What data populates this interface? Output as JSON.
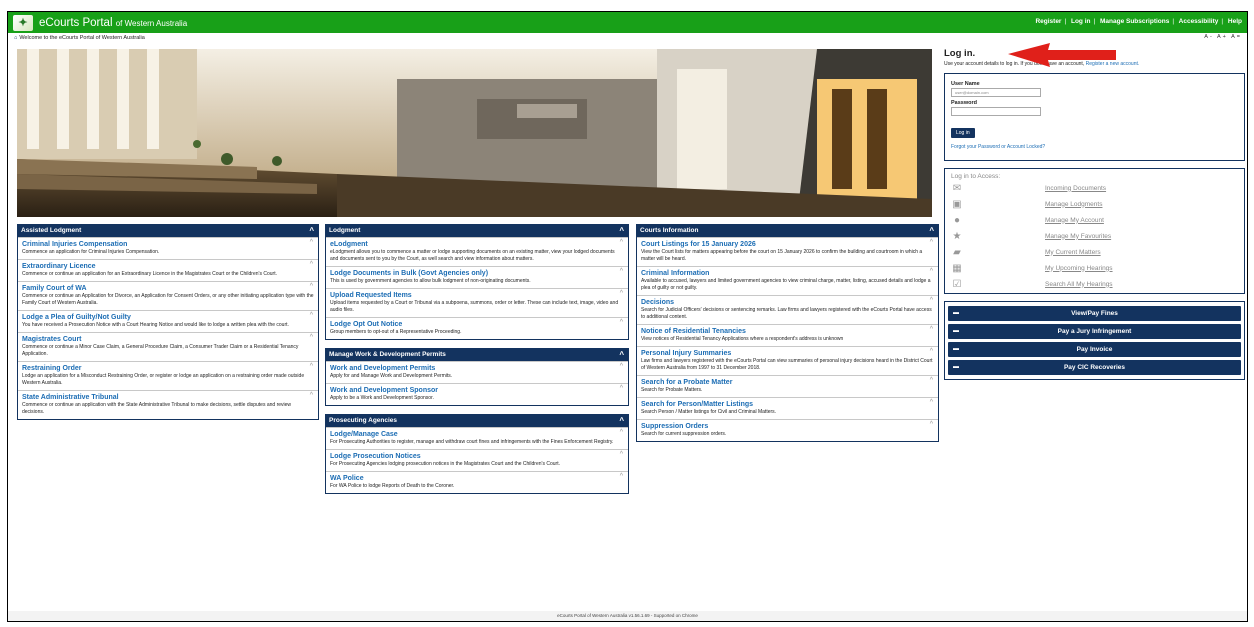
{
  "header": {
    "brand_main": "eCourts Portal",
    "brand_sub": "of Western Australia",
    "links": [
      "Register",
      "Log in",
      "Manage Subscriptions",
      "Accessibility",
      "Help"
    ]
  },
  "welcome": "Welcome to the eCourts Portal of Western Australia",
  "fontsize": "A- A+ A=",
  "panels": {
    "assisted": {
      "title": "Assisted Lodgment",
      "items": [
        {
          "title": "Criminal Injuries Compensation",
          "desc": "Commence an application for Criminal Injuries Compensation."
        },
        {
          "title": "Extraordinary Licence",
          "desc": "Commence or continue an application for an Extraordinary Licence in the Magistrates Court or the Children's Court."
        },
        {
          "title": "Family Court of WA",
          "desc": "Commence or continue an Application for Divorce, an Application for Consent Orders, or any other initiating application type with the Family Court of Western Australia."
        },
        {
          "title": "Lodge a Plea of Guilty/Not Guilty",
          "desc": "You have received a Prosecution Notice with a Court Hearing Notice and would like to lodge a written plea with the court."
        },
        {
          "title": "Magistrates Court",
          "desc": "Commence or continue a Minor Case Claim, a General Procedure Claim, a Consumer Trader Claim or a Residential Tenancy Application."
        },
        {
          "title": "Restraining Order",
          "desc": "Lodge an application for a Misconduct Restraining Order, or register or lodge an application on a restraining order made outside Western Australia."
        },
        {
          "title": "State Administrative Tribunal",
          "desc": "Commence or continue an application with the State Administrative Tribunal to make decisions, settle disputes and review decisions."
        }
      ]
    },
    "lodgment": {
      "title": "Lodgment",
      "items": [
        {
          "title": "eLodgment",
          "desc": "eLodgment allows you to commence a matter or lodge supporting documents on an existing matter, view your lodged documents and documents sent to you by the Court, as well search and view information about matters."
        },
        {
          "title": "Lodge Documents in Bulk (Govt Agencies only)",
          "desc": "This is used by government agencies to allow bulk lodgment of non-originating documents."
        },
        {
          "title": "Upload Requested Items",
          "desc": "Upload items requested by a Court or Tribunal via a subpoena, summons, order or letter. These can include text, image, video and audio files."
        },
        {
          "title": "Lodge Opt Out Notice",
          "desc": "Group members to opt-out of a Representative Proceeding."
        }
      ]
    },
    "workdev": {
      "title": "Manage Work & Development Permits",
      "items": [
        {
          "title": "Work and Development Permits",
          "desc": "Apply for and Manage Work and Development Permits."
        },
        {
          "title": "Work and Development Sponsor",
          "desc": "Apply to be a Work and Development Sponsor."
        }
      ]
    },
    "prosecuting": {
      "title": "Prosecuting Agencies",
      "items": [
        {
          "title": "Lodge/Manage Case",
          "desc": "For Prosecuting Authorities to register, manage and withdraw court fines and infringements with the Fines Enforcement Registry."
        },
        {
          "title": "Lodge Prosecution Notices",
          "desc": "For Prosecuting Agencies lodging prosecution notices in the Magistrates Court and the Children's Court."
        },
        {
          "title": "WA Police",
          "desc": "For WA Police to lodge Reports of Death to the Coroner."
        }
      ]
    },
    "courts": {
      "title": "Courts Information",
      "items": [
        {
          "title": "Court Listings for 15 January 2026",
          "desc": "View the Court lists for matters appearing before the court on 15 January 2026 to confirm the building and courtroom in which a matter will be heard."
        },
        {
          "title": "Criminal Information",
          "desc": "Available to accused, lawyers and limited government agencies to view criminal charge, matter, listing, accused details and lodge a plea of guilty or not guilty."
        },
        {
          "title": "Decisions",
          "desc": "Search for Judicial Officers' decisions or sentencing remarks. Law firms and lawyers registered with the eCourts Portal have access to additional content."
        },
        {
          "title": "Notice of Residential Tenancies",
          "desc": "View notices of Residential Tenancy Applications where a respondent's address is unknown"
        },
        {
          "title": "Personal Injury Summaries",
          "desc": "Law firms and lawyers registered with the eCourts Portal can view summaries of personal injury decisions heard in the District Court of Western Australia from 1997 to 31 December 2018."
        },
        {
          "title": "Search for a Probate Matter",
          "desc": "Search for Probate Matters."
        },
        {
          "title": "Search for Person/Matter Listings",
          "desc": "Search Person / Matter listings for Civil and Criminal Matters."
        },
        {
          "title": "Suppression Orders",
          "desc": "Search for current suppression orders."
        }
      ]
    }
  },
  "login": {
    "heading": "Log in.",
    "intro_text": "Use your account details to log in. If you don't have an account,",
    "intro_link": "Register a new account.",
    "username_label": "User Name",
    "username_placeholder": "user@domain.com",
    "password_label": "Password",
    "button": "Log in",
    "forgot": "Forgot your Password or Account Locked?"
  },
  "access": {
    "heading": "Log in to Access:",
    "items": [
      {
        "icon": "envelope-icon",
        "label": "Incoming Documents"
      },
      {
        "icon": "briefcase-icon",
        "label": "Manage Lodgments"
      },
      {
        "icon": "user-icon",
        "label": "Manage My Account"
      },
      {
        "icon": "star-icon",
        "label": "Manage My Favourites"
      },
      {
        "icon": "folder-icon",
        "label": "My Current Matters"
      },
      {
        "icon": "calendar-icon",
        "label": "My Upcoming Hearings"
      },
      {
        "icon": "calendar-check-icon",
        "label": "Search All My Hearings"
      }
    ]
  },
  "payments": [
    "View/Pay Fines",
    "Pay a Jury Infringement",
    "Pay Invoice",
    "Pay CIC Recoveries"
  ],
  "footer": "eCourts Portal of Western Australia v1.56.1.69 - Supported on Chrome",
  "colors": {
    "topbar": "#18a018",
    "navy": "#13335f",
    "link": "#1c6db4",
    "arrow": "#e0201a"
  }
}
